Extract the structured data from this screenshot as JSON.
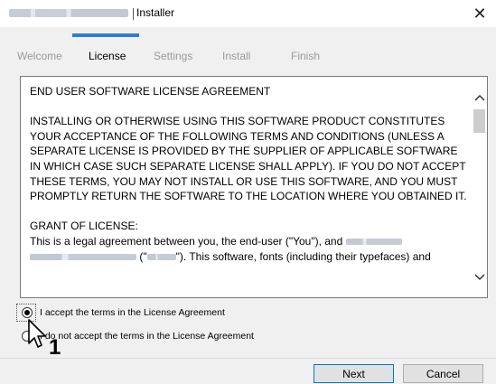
{
  "window": {
    "title": "Installer",
    "close_glyph": "✕",
    "close_icon": "close-icon"
  },
  "tabs": [
    {
      "label": "Welcome",
      "active": false
    },
    {
      "label": "License",
      "active": true
    },
    {
      "label": "Settings",
      "active": false
    },
    {
      "label": "Install",
      "active": false
    },
    {
      "label": "Finish",
      "active": false
    }
  ],
  "license": {
    "heading": "END USER SOFTWARE LICENSE AGREEMENT",
    "paragraph1": "INSTALLING OR OTHERWISE USING THIS SOFTWARE PRODUCT CONSTITUTES YOUR ACCEPTANCE OF THE FOLLOWING TERMS AND CONDITIONS (UNLESS A SEPARATE LICENSE IS PROVIDED BY THE SUPPLIER OF APPLICABLE SOFTWARE IN WHICH CASE SUCH SEPARATE LICENSE SHALL APPLY). IF YOU DO NOT ACCEPT THESE TERMS, YOU MAY NOT INSTALL OR USE THIS SOFTWARE, AND YOU MUST PROMPTLY RETURN THE SOFTWARE TO THE LOCATION WHERE YOU OBTAINED IT.",
    "grant_heading": "GRANT OF LICENSE:",
    "grant_part1": "This is a legal agreement between you, the end-user (\"You\"), and",
    "grant_part2": "(\"",
    "grant_part3": "\"). This software, fonts (including their typefaces) and"
  },
  "radios": {
    "accept_label": "I accept the terms in the License Agreement",
    "decline_label": "I do not accept the terms in the License Agreement",
    "selected": "accept"
  },
  "annotation": {
    "step_number": "1"
  },
  "buttons": {
    "next": "Next",
    "cancel": "Cancel"
  },
  "colors": {
    "accent": "#2f7dd1",
    "inactive_tab": "#9a9a9a"
  }
}
